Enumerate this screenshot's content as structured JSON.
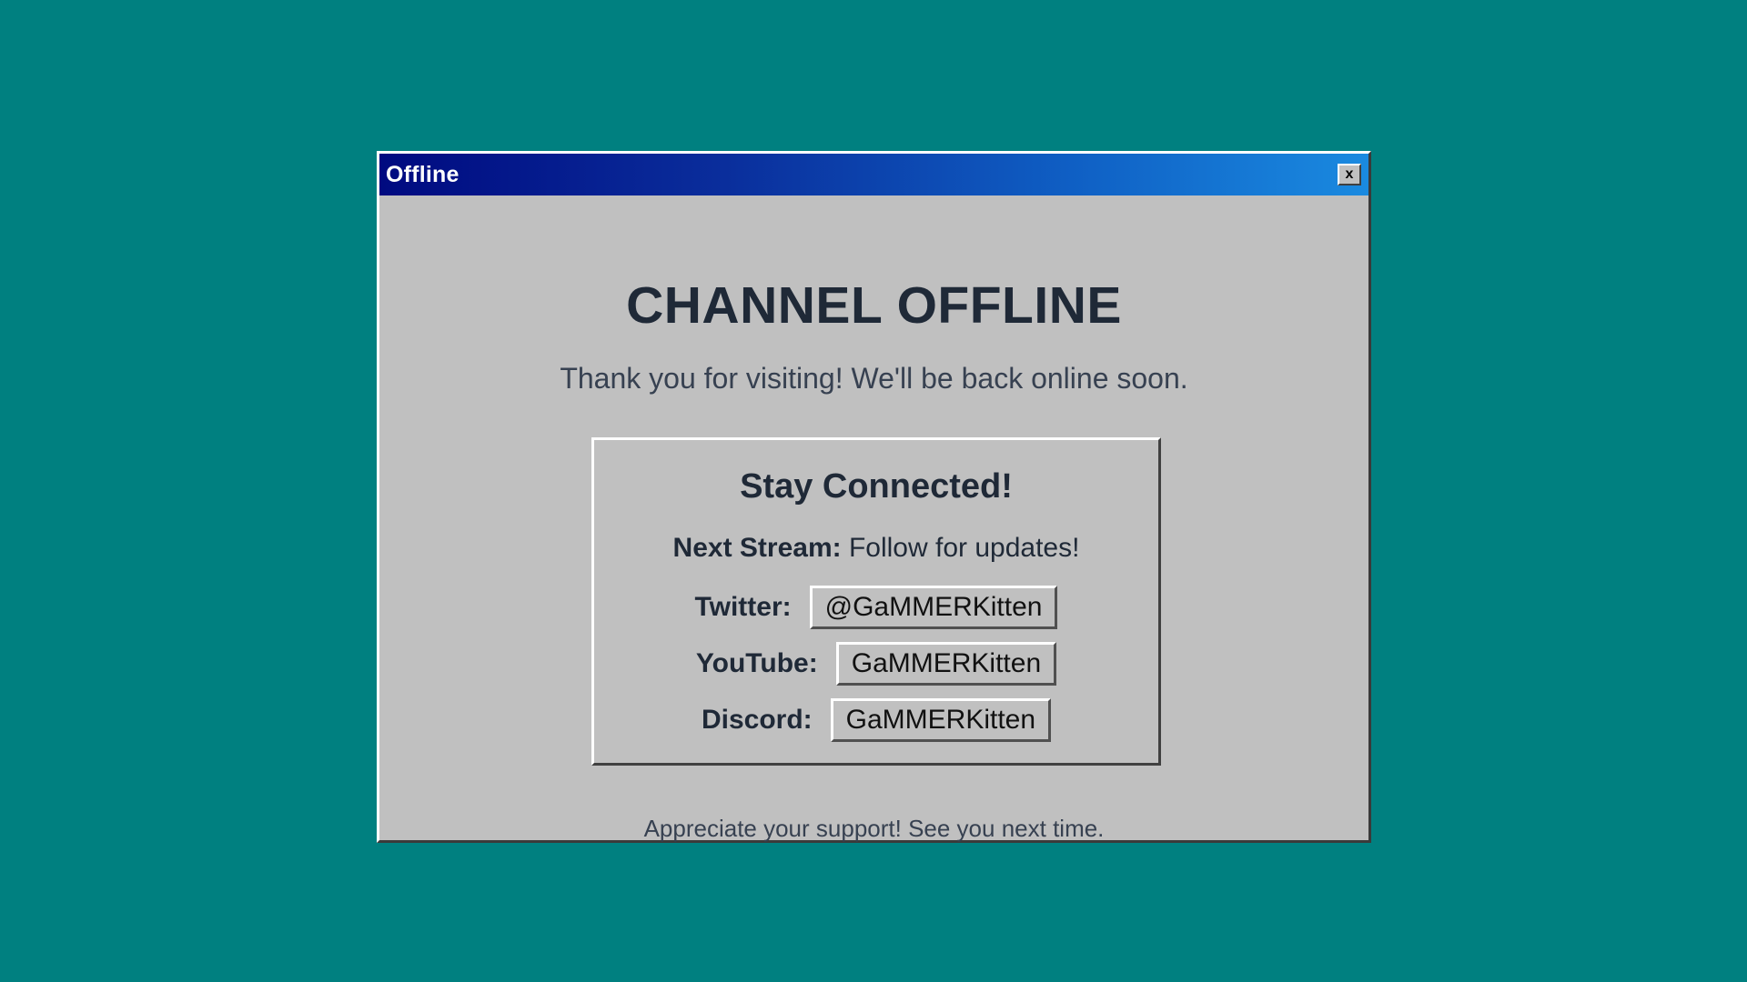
{
  "window": {
    "title": "Offline",
    "close_label": "x"
  },
  "main": {
    "heading": "CHANNEL OFFLINE",
    "subtext": "Thank you for visiting! We'll be back online soon.",
    "footer": "Appreciate your support! See you next time."
  },
  "panel": {
    "heading": "Stay Connected!",
    "next_stream_label": "Next Stream:",
    "next_stream_value": "Follow for updates!",
    "socials": [
      {
        "label": "Twitter:",
        "handle": "@GaMMERKitten"
      },
      {
        "label": "YouTube:",
        "handle": "GaMMERKitten"
      },
      {
        "label": "Discord:",
        "handle": "GaMMERKitten"
      }
    ]
  },
  "colors": {
    "desktop_background": "#008080",
    "window_face": "#c0c0c0",
    "titlebar_start": "#000a80",
    "titlebar_end": "#1a8ae0",
    "text": "#1f2937"
  },
  "icons": {
    "close": "close-icon"
  }
}
